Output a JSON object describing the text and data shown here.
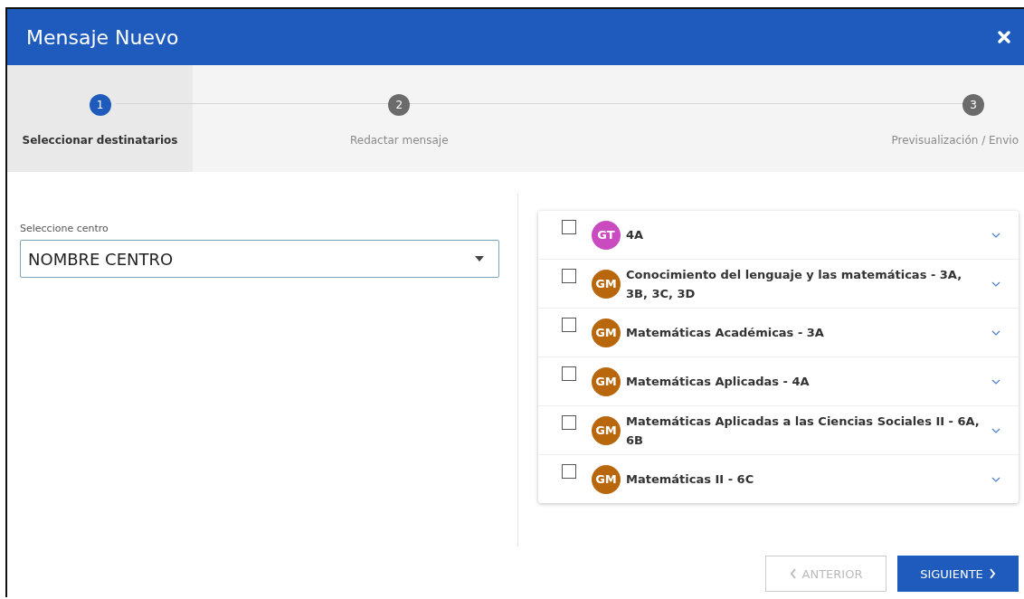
{
  "window": {
    "title": "Mensaje Nuevo"
  },
  "steps": [
    {
      "number": "1",
      "label": "Seleccionar destinatarios",
      "selected": true
    },
    {
      "number": "2",
      "label": "Redactar mensaje",
      "selected": false
    },
    {
      "number": "3",
      "label": "Previsualización / Envio",
      "selected": false
    }
  ],
  "centre_select": {
    "label": "Seleccione centro",
    "value": "NOMBRE CENTRO"
  },
  "groups": [
    {
      "badge": "GT",
      "color": "#c94bbf",
      "name": "4A",
      "checked": false
    },
    {
      "badge": "GM",
      "color": "#b8670c",
      "name": "Conocimiento del lenguaje y las matemáticas - 3A, 3B, 3C, 3D",
      "checked": false
    },
    {
      "badge": "GM",
      "color": "#b8670c",
      "name": "Matemáticas Académicas - 3A",
      "checked": false
    },
    {
      "badge": "GM",
      "color": "#b8670c",
      "name": "Matemáticas Aplicadas - 4A",
      "checked": false
    },
    {
      "badge": "GM",
      "color": "#b8670c",
      "name": "Matemáticas Aplicadas a las Ciencias Sociales II - 6A, 6B",
      "checked": false
    },
    {
      "badge": "GM",
      "color": "#b8670c",
      "name": "Matemáticas II - 6C",
      "checked": false
    }
  ],
  "buttons": [
    {
      "label": "ANTERIOR",
      "kind": "back",
      "disabled": true
    },
    {
      "label": "SIGUIENTE",
      "kind": "next",
      "disabled": false
    }
  ]
}
